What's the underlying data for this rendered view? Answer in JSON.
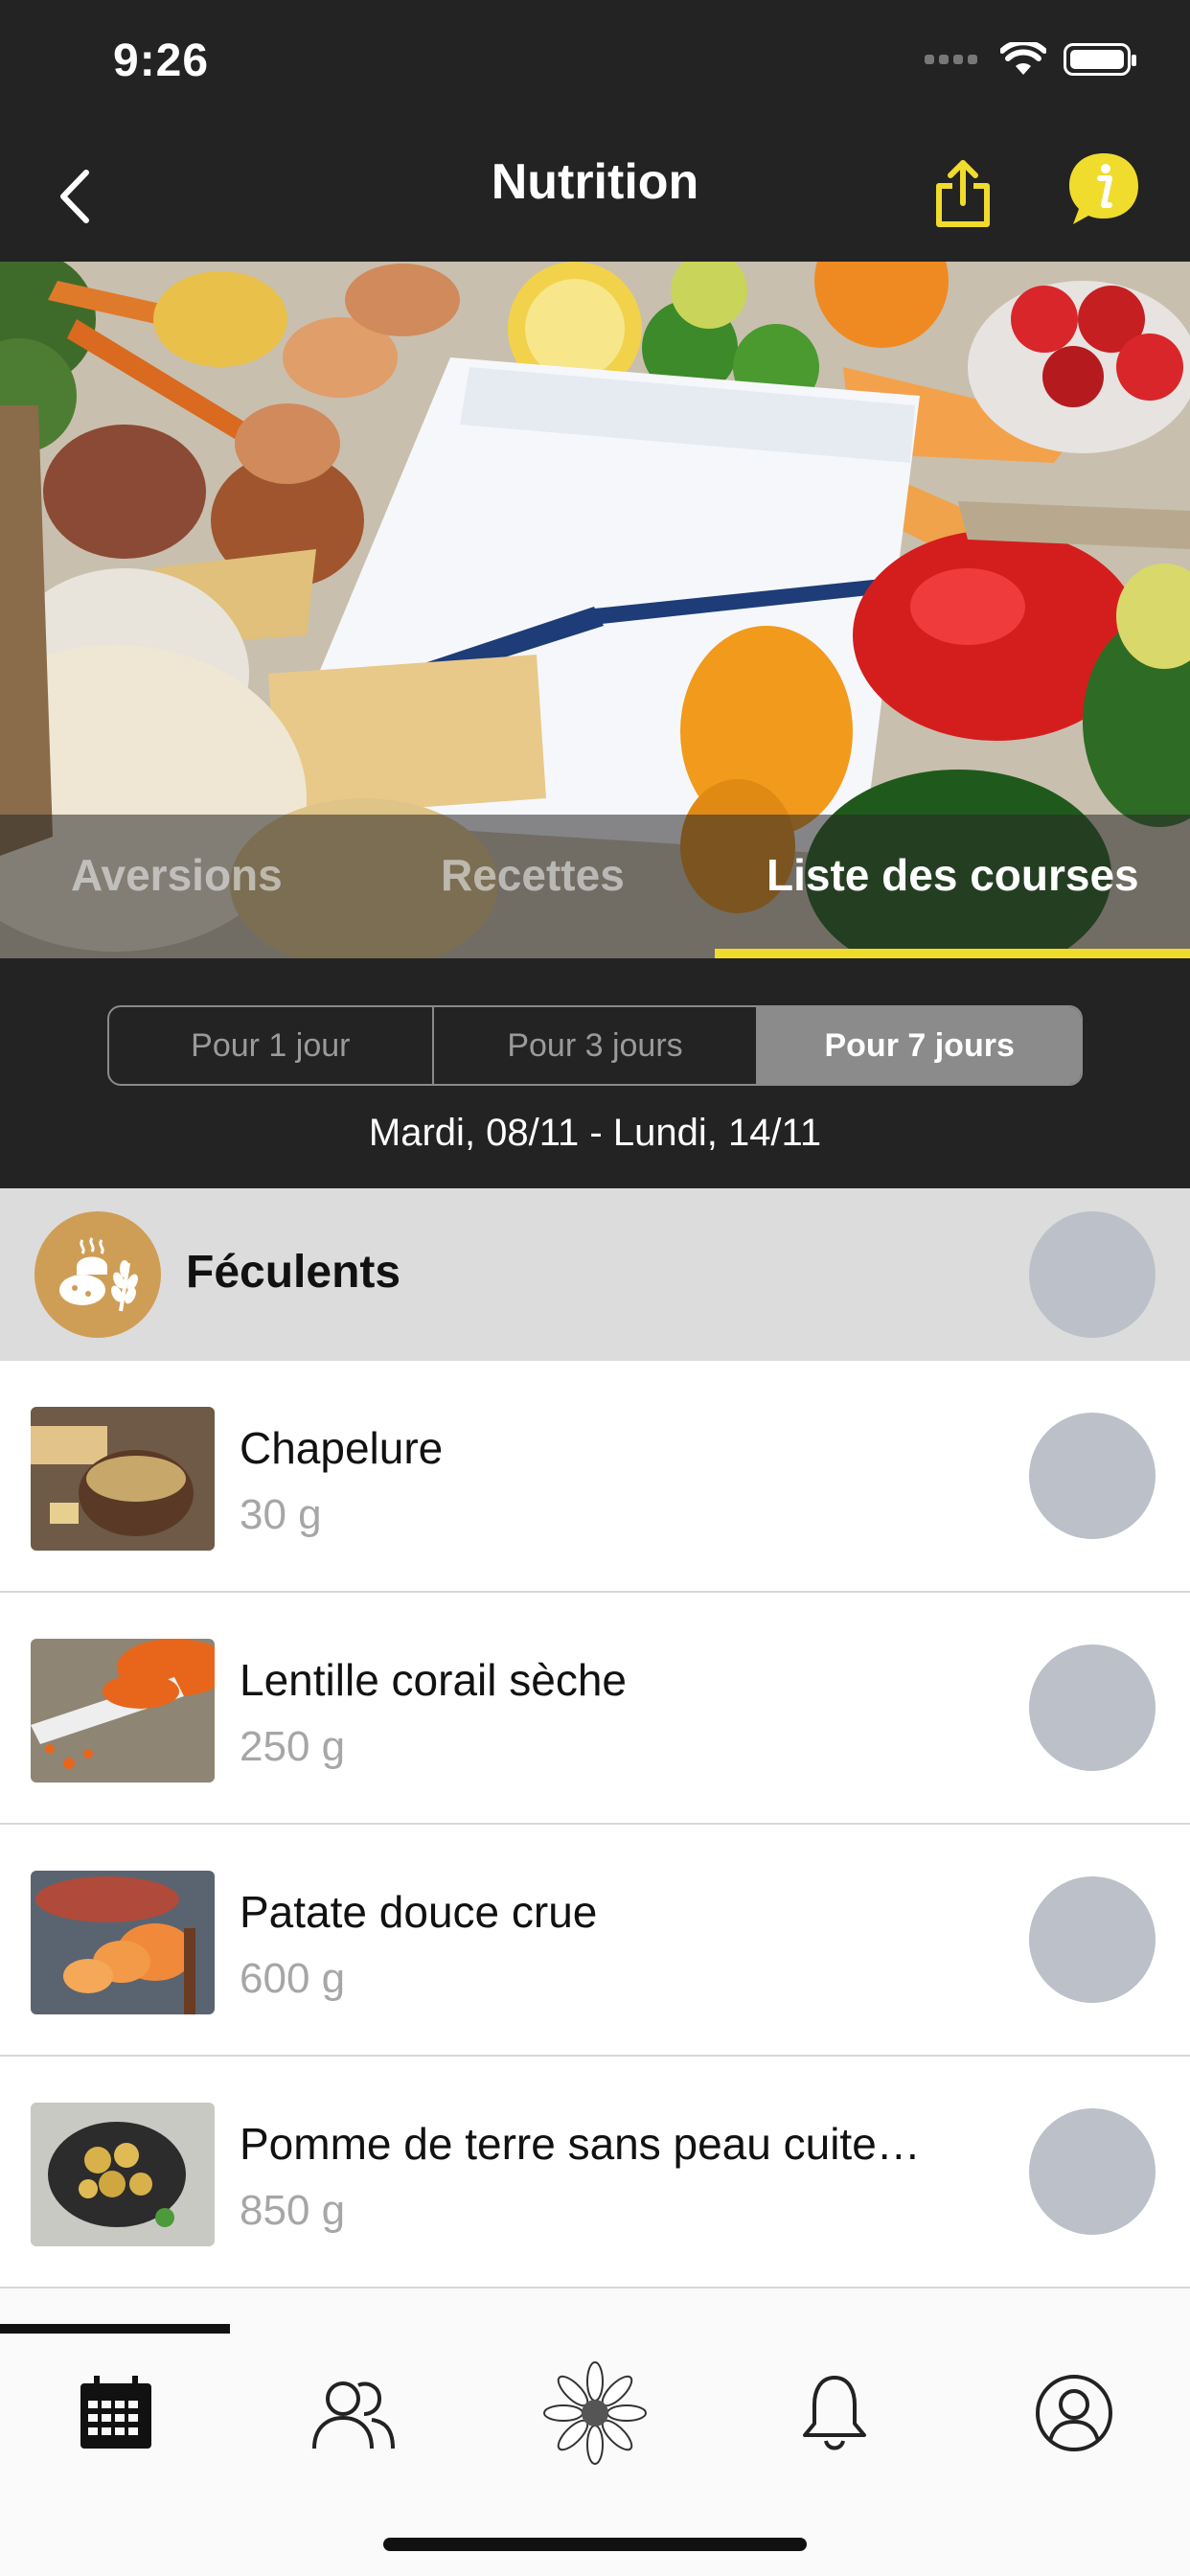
{
  "status_bar": {
    "time": "9:26"
  },
  "nav": {
    "title": "Nutrition"
  },
  "tabs": [
    {
      "label": "Aversions"
    },
    {
      "label": "Recettes"
    },
    {
      "label": "Liste des courses",
      "active": true
    }
  ],
  "duration": {
    "options": [
      "Pour 1 jour",
      "Pour 3 jours",
      "Pour 7 jours"
    ],
    "selected": "Pour 7 jours",
    "date_range": "Mardi, 08/11 - Lundi, 14/11"
  },
  "category": {
    "title": "Féculents"
  },
  "items": [
    {
      "name": "Chapelure",
      "qty": "30 g"
    },
    {
      "name": "Lentille corail sèche",
      "qty": "250 g"
    },
    {
      "name": "Patate douce crue",
      "qty": "600 g"
    },
    {
      "name": "Pomme de terre sans peau cuite…",
      "qty": "850 g"
    }
  ],
  "colors": {
    "accent": "#f0dc2c",
    "dark": "#232323",
    "category_icon": "#cf9e56",
    "check": "#bcc1c9"
  },
  "bottom_tabs": [
    "calendar-icon",
    "community-icon",
    "flower-icon",
    "bell-icon",
    "profile-icon"
  ]
}
